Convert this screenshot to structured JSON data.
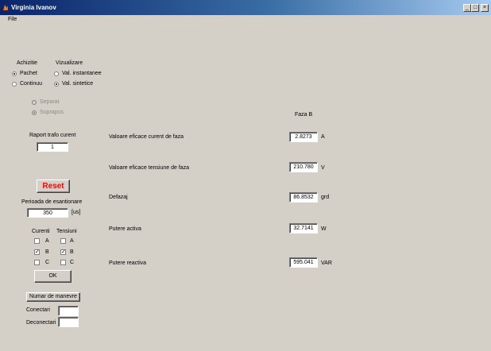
{
  "window": {
    "title": "Virginia Ivanov",
    "minimize": "_",
    "maximize": "□",
    "close": "×"
  },
  "menu": {
    "file": "File"
  },
  "modes": {
    "achizitie_label": "Achizitie",
    "pachet": "Pachet",
    "continuu": "Continuu",
    "vizualizare_label": "Vizualizare",
    "val_instantanee": "Val. instantanee",
    "val_sintetice": "Val. sintetice",
    "separat": "Separat",
    "suprapus": "Suprapus"
  },
  "raport": {
    "label": "Raport trafo curent",
    "value": "1"
  },
  "reset": {
    "label": "Reset"
  },
  "perioada": {
    "label": "Perioada de esantionare",
    "value": "350",
    "unit": "[us]"
  },
  "channels": {
    "curenti_label": "Curenti",
    "tensiuni_label": "Tensiuni",
    "a": "A",
    "b": "B",
    "c": "C",
    "check_mark": "✓",
    "ok_label": "OK"
  },
  "manevre": {
    "button_label": "Numar de manevre",
    "conectari_label": "Conectari",
    "deconectari_label": "Deconectari",
    "conectari_value": "",
    "deconectari_value": ""
  },
  "measurements": {
    "header": "Faza B",
    "rows": [
      {
        "label": "Valoare eficace curent de faza",
        "value": "2.8273",
        "unit": "A"
      },
      {
        "label": "Valoare eficace tensiune de faza",
        "value": "210.780",
        "unit": "V"
      },
      {
        "label": "Defazaj",
        "value": "86.8532",
        "unit": "grd"
      },
      {
        "label": "Putere activa",
        "value": "32.7141",
        "unit": "W"
      },
      {
        "label": "Putere reactiva",
        "value": "595.041",
        "unit": "VAR"
      }
    ]
  }
}
